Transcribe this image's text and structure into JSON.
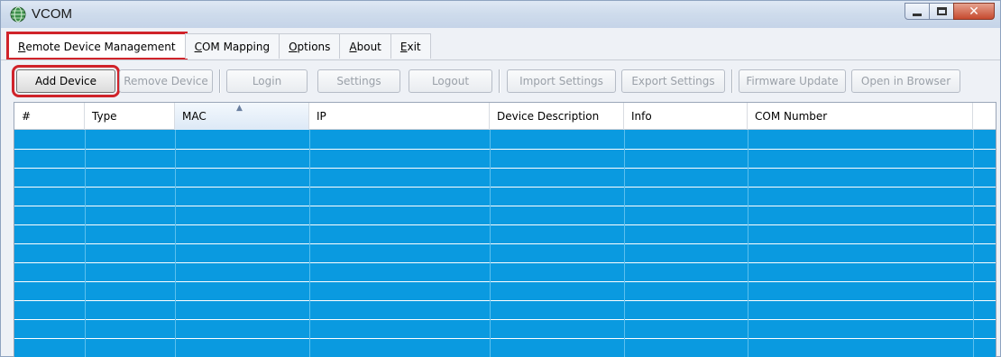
{
  "window": {
    "title": "VCOM",
    "icon": "globe-icon"
  },
  "menu": [
    {
      "label": "Remote Device Management",
      "underline": "R",
      "rest": "emote Device Management"
    },
    {
      "label": "COM Mapping",
      "underline": "C",
      "rest": "OM Mapping"
    },
    {
      "label": "Options",
      "underline": "O",
      "rest": "ptions"
    },
    {
      "label": "About",
      "underline": "A",
      "rest": "bout"
    },
    {
      "label": "Exit",
      "underline": "E",
      "rest": "xit"
    }
  ],
  "toolbar": {
    "add_device": "Add Device",
    "remove_device": "Remove Device",
    "login": "Login",
    "settings": "Settings",
    "logout": "Logout",
    "import_settings": "Import Settings",
    "export_settings": "Export Settings",
    "firmware_update": "Firmware Update",
    "open_in_browser": "Open in Browser"
  },
  "grid": {
    "columns": [
      "#",
      "Type",
      "MAC",
      "IP",
      "Device Description",
      "Info",
      "COM Number"
    ],
    "sorted_column": "MAC",
    "row_color": "#0a9ae0"
  }
}
